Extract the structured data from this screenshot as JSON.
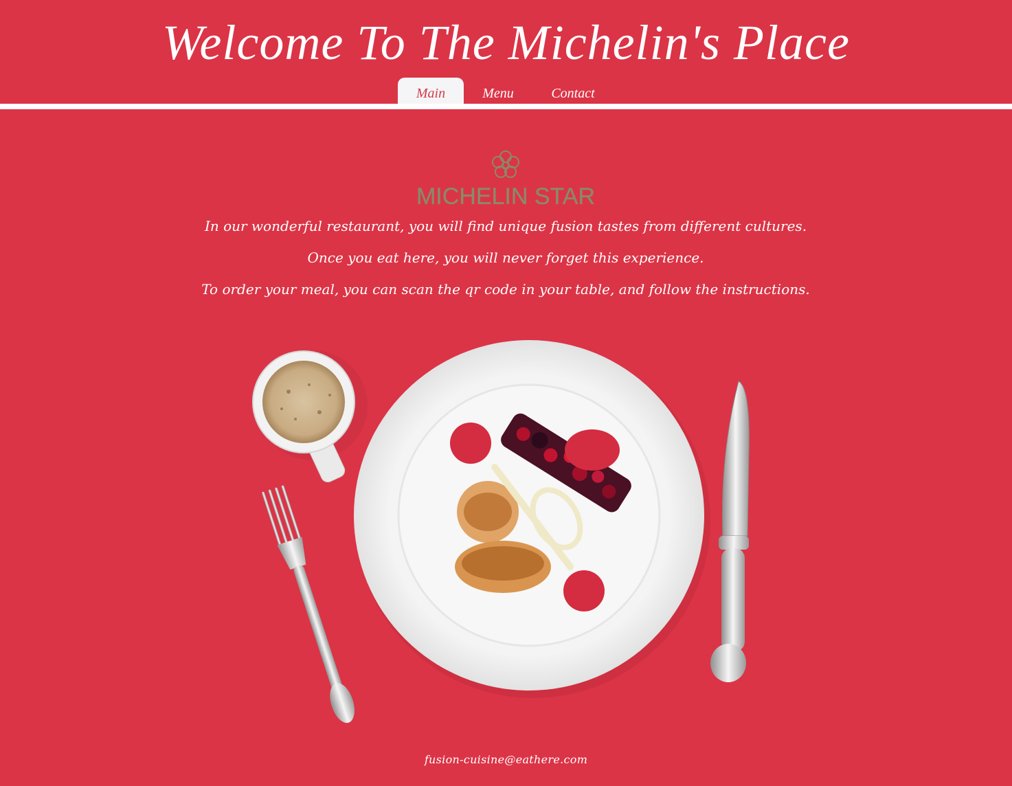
{
  "header": {
    "title": "Welcome To The Michelin's Place"
  },
  "nav": {
    "tabs": [
      {
        "label": "Main",
        "active": true
      },
      {
        "label": "Menu",
        "active": false
      },
      {
        "label": "Contact",
        "active": false
      }
    ]
  },
  "logo": {
    "text": "MICHELIN STAR",
    "color": "#8a8a6a"
  },
  "intro": {
    "lines": [
      "In our wonderful restaurant, you will find unique fusion tastes from different cultures.",
      "Once you eat here, you will never forget this experience.",
      "To order your meal, you can scan the qr code in your table, and follow the instructions."
    ]
  },
  "hero": {
    "icon": "plated-dish-image"
  },
  "footer": {
    "email": "fusion-cuisine@eathere.com"
  },
  "colors": {
    "background": "#db3446",
    "active_tab_bg": "#f5f5f7",
    "active_tab_text": "#d23b4a",
    "text": "#ffffff"
  }
}
